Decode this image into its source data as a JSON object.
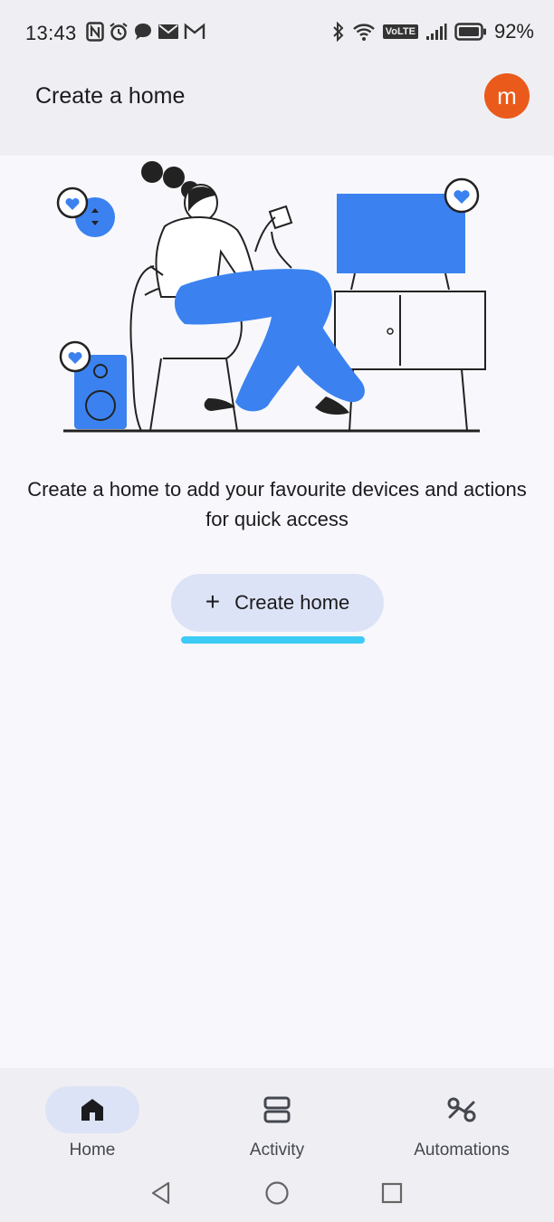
{
  "status_bar": {
    "time": "13:43",
    "battery_percent": "92%",
    "network_badge": "VoLTE"
  },
  "app_bar": {
    "title": "Create a home",
    "avatar_letter": "m"
  },
  "main": {
    "message": "Create a home to add your favourite devices and actions for quick access",
    "create_button": {
      "icon": "+",
      "label": "Create home"
    }
  },
  "bottom_nav": {
    "items": [
      {
        "label": "Home",
        "icon": "home-icon",
        "active": true
      },
      {
        "label": "Activity",
        "icon": "activity-icon",
        "active": false
      },
      {
        "label": "Automations",
        "icon": "automations-icon",
        "active": false
      }
    ]
  },
  "colors": {
    "accent_blue": "#3b82f0",
    "avatar_orange": "#ea5a1b",
    "button_fill": "#dde3f6",
    "highlight_cyan": "#3ccbf4"
  }
}
